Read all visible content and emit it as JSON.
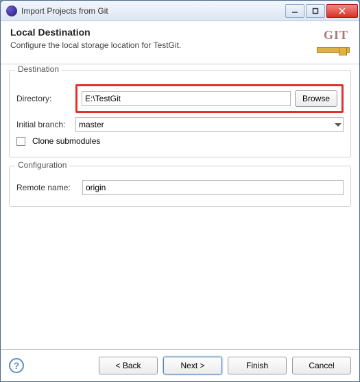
{
  "window": {
    "title": "Import Projects from Git"
  },
  "header": {
    "title": "Local Destination",
    "subtitle": "Configure the local storage location for TestGit.",
    "logo_text": "GIT"
  },
  "destination": {
    "group_label": "Destination",
    "directory_label": "Directory:",
    "directory_value": "E:\\TestGit",
    "browse_label": "Browse",
    "initial_branch_label": "Initial branch:",
    "initial_branch_value": "master",
    "clone_submodules_label": "Clone submodules",
    "clone_submodules_checked": false
  },
  "configuration": {
    "group_label": "Configuration",
    "remote_name_label": "Remote name:",
    "remote_name_value": "origin"
  },
  "buttons": {
    "back": "< Back",
    "next": "Next >",
    "finish": "Finish",
    "cancel": "Cancel"
  }
}
